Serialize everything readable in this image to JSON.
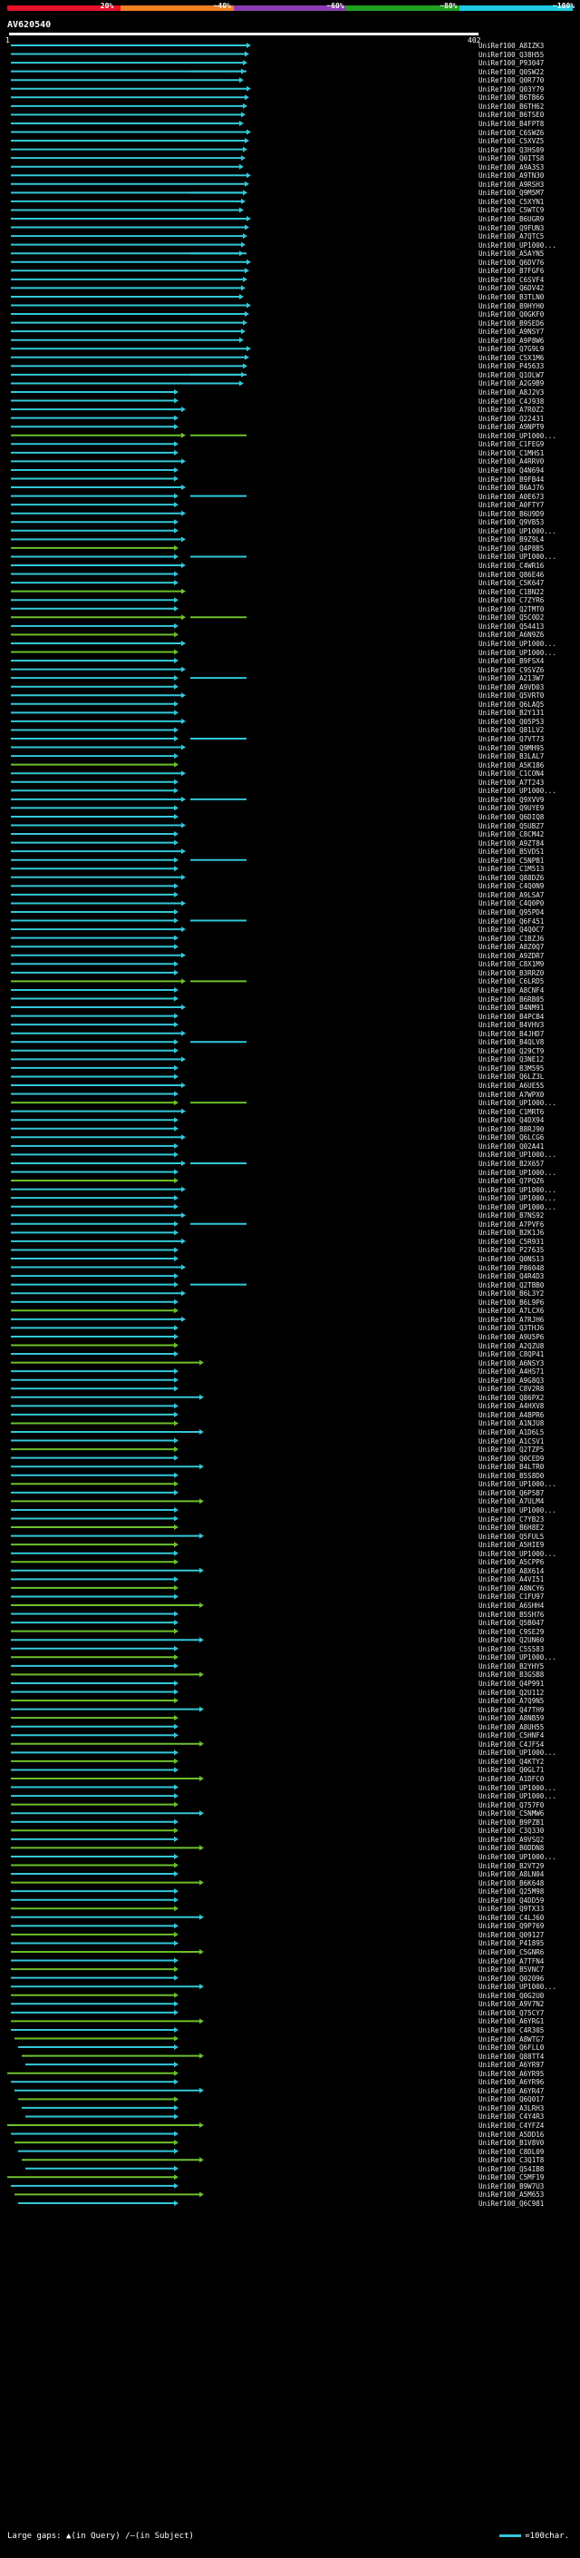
{
  "legend": {
    "labels": [
      "20%",
      "~40%",
      "~60%",
      "~80%",
      "~100%"
    ],
    "colors": [
      "#e8102a",
      "#f08020",
      "#8a3db0",
      "#20a020",
      "#20c8e0"
    ]
  },
  "query": {
    "name": "AV620540",
    "start": "1",
    "end": "402"
  },
  "hits": [
    "UniRef100_A8IZK3",
    "UniRef100_Q38H55",
    "UniRef100_P93047",
    "UniRef100_Q0SW22",
    "UniRef100_Q0R770",
    "UniRef100_Q03Y79",
    "UniRef100_B6TB66",
    "UniRef100_B6TH62",
    "UniRef100_B6TSE0",
    "UniRef100_B4FPT8",
    "UniRef100_C6SWZ6",
    "UniRef100_C5XVZ5",
    "UniRef100_Q3HS09",
    "UniRef100_Q0ITS8",
    "UniRef100_A9A3S3",
    "UniRef100_A9TN30",
    "UniRef100_A9RSH3",
    "UniRef100_Q9M5M7",
    "UniRef100_C5XYN1",
    "UniRef100_C5WTC9",
    "UniRef100_B6UGR9",
    "UniRef100_Q9FUN3",
    "UniRef100_A7QTC5",
    "UniRef100_UP1000...",
    "UniRef100_A5AYN5",
    "UniRef100_Q6DV76",
    "UniRef100_B7FGF6",
    "UniRef100_C6SVF4",
    "UniRef100_Q6DV42",
    "UniRef100_B3TLN0",
    "UniRef100_B9HYH0",
    "UniRef100_Q0GKF0",
    "UniRef100_B9SED6",
    "UniRef100_A9NSY7",
    "UniRef100_A9P8W6",
    "UniRef100_Q7G9L9",
    "UniRef100_C5X1M6",
    "UniRef100_P45633",
    "UniRef100_Q1OLW7",
    "UniRef100_A2G9B9",
    "UniRef100_A8J2V3",
    "UniRef100_C4J938",
    "UniRef100_A7R0Z2",
    "UniRef100_Q22431",
    "UniRef100_A9NPT9",
    "UniRef100_UP1000...",
    "UniRef100_C1FEG9",
    "UniRef100_C1MHS1",
    "UniRef100_A4RRV0",
    "UniRef100_Q4N694",
    "UniRef100_B9FB44",
    "UniRef100_B6AJ76",
    "UniRef100_A0E673",
    "UniRef100_A0FTY7",
    "UniRef100_B6U9D9",
    "UniRef100_Q9VB53",
    "UniRef100_UP1000...",
    "UniRef100_B9Z9L4",
    "UniRef100_Q4P8B5",
    "UniRef100_UP1000...",
    "UniRef100_C4WR16",
    "UniRef100_Q86E46",
    "UniRef100_C5K647",
    "UniRef100_C1BN22",
    "UniRef100_C7ZYR6",
    "UniRef100_Q2TMT0",
    "UniRef100_Q5C0D2",
    "UniRef100_Q54413",
    "UniRef100_A6N9Z6",
    "UniRef100_UP1000...",
    "UniRef100_UP1000...",
    "UniRef100_B9FSX4",
    "UniRef100_C9SVZ6",
    "UniRef100_A213W7",
    "UniRef100_A9VD03",
    "UniRef100_Q5VRT0",
    "UniRef100_Q6LAQ5",
    "UniRef100_B2Y131",
    "UniRef100_Q05P53",
    "UniRef100_Q81LV2",
    "UniRef100_Q7VT73",
    "UniRef100_Q9MH95",
    "UniRef100_B3LAL7",
    "UniRef100_A5K186",
    "UniRef100_C1CON4",
    "UniRef100_A7T243",
    "UniRef100_UP1000...",
    "UniRef100_Q9XVV9",
    "UniRef100_Q9UYE9",
    "UniRef100_Q6DIQ8",
    "UniRef100_Q5UBZ7",
    "UniRef100_C8CM42",
    "UniRef100_A9ZT84",
    "UniRef100_B5VDS1",
    "UniRef100_C5NPB1",
    "UniRef100_C1M513",
    "UniRef100_Q88DZ6",
    "UniRef100_C4Q0N9",
    "UniRef100_A9LSA7",
    "UniRef100_C4Q0P0",
    "UniRef100_Q95PD4",
    "UniRef100_Q6F451",
    "UniRef100_Q4Q0C7",
    "UniRef100_C1BZJ6",
    "UniRef100_A8Z0Q7",
    "UniRef100_A9ZDR7",
    "UniRef100_C8X1M9",
    "UniRef100_B3RRZ0",
    "UniRef100_C6LRD5",
    "UniRef100_A8CNF4",
    "UniRef100_B6RB05",
    "UniRef100_B4NM91",
    "UniRef100_B4PCB4",
    "UniRef100_B4VHV3",
    "UniRef100_B4JHD7",
    "UniRef100_B4QLV8",
    "UniRef100_Q29CT9",
    "UniRef100_Q3NE12",
    "UniRef100_B3M595",
    "UniRef100_Q6LZ3L",
    "UniRef100_A6UE55",
    "UniRef100_A7WPX0",
    "UniRef100_UP1000...",
    "UniRef100_C1MRT6",
    "UniRef100_Q4DX94",
    "UniRef100_B8RJ90",
    "UniRef100_Q6LCG6",
    "UniRef100_Q02A41",
    "UniRef100_UP1000...",
    "UniRef100_B2X657",
    "UniRef100_UP1000...",
    "UniRef100_Q7PQZ6",
    "UniRef100_UP1000...",
    "UniRef100_UP1000...",
    "UniRef100_UP1000...",
    "UniRef100_B7NS92",
    "UniRef100_A7PVF6",
    "UniRef100_B2K1J6",
    "UniRef100_C5R931",
    "UniRef100_P27635",
    "UniRef100_Q0NS13",
    "UniRef100_P86048",
    "UniRef100_Q4R4D3",
    "UniRef100_Q2TBB0",
    "UniRef100_B6L3Y2",
    "UniRef100_B6L9P6",
    "UniRef100_A7LCX6",
    "UniRef100_A7RJH6",
    "UniRef100_Q3THJ6",
    "UniRef100_A9U5P6",
    "UniRef100_A2QZU8",
    "UniRef100_C8QP41",
    "UniRef100_A6NSY3",
    "UniRef100_A4HS71",
    "UniRef100_A9G8Q3",
    "UniRef100_C8V2R8",
    "UniRef100_Q86PX2",
    "UniRef100_A4HXV8",
    "UniRef100_A4BPR6",
    "UniRef100_A1NJU8",
    "UniRef100_A1D6L5",
    "UniRef100_A1CSV1",
    "UniRef100_Q2TZP5",
    "UniRef100_Q0CED9",
    "UniRef100_B4LTR0",
    "UniRef100_B5S8D0",
    "UniRef100_UP1000...",
    "UniRef100_Q6P5B7",
    "UniRef100_A7ULM4",
    "UniRef100_UP1000...",
    "UniRef100_C7YB23",
    "UniRef100_B6H8E2",
    "UniRef100_Q5FUL5",
    "UniRef100_A5HIE9",
    "UniRef100_UP1000...",
    "UniRef100_A5CPP6",
    "UniRef100_A8X614",
    "UniRef100_A4VI51",
    "UniRef100_A8NCY6",
    "UniRef100_C1FU97",
    "UniRef100_A6SHH4",
    "UniRef100_B5SH76",
    "UniRef100_Q5B047",
    "UniRef100_C9SE29",
    "UniRef100_Q2UN60",
    "UniRef100_C5S583",
    "UniRef100_UP1000...",
    "UniRef100_B2YHY5",
    "UniRef100_B3GSB8",
    "UniRef100_Q4P991",
    "UniRef100_Q2U112",
    "UniRef100_A7Q9N5",
    "UniRef100_Q47TH9",
    "UniRef100_A8NB59",
    "UniRef100_A8UH55",
    "UniRef100_C5HNF4",
    "UniRef100_C4JFS4",
    "UniRef100_UP1000...",
    "UniRef100_Q4KTY2",
    "UniRef100_Q0GL71",
    "UniRef100_A1DFC0",
    "UniRef100_UP1000...",
    "UniRef100_UP1000...",
    "UniRef100_Q757F0",
    "UniRef100_C5NMW6",
    "UniRef100_B9PZB1",
    "UniRef100_C3Q330",
    "UniRef100_A9VSQ2",
    "UniRef100_B0DDN8",
    "UniRef100_UP1000...",
    "UniRef100_B2VT29",
    "UniRef100_A8LN04",
    "UniRef100_B6K648",
    "UniRef100_Q25M98",
    "UniRef100_Q4DD59",
    "UniRef100_Q9TX33",
    "UniRef100_C4LJ60",
    "UniRef100_Q9P769",
    "UniRef100_Q09127",
    "UniRef100_P41895",
    "UniRef100_C5GNR6",
    "UniRef100_A7TFN4",
    "UniRef100_B5VNC7",
    "UniRef100_Q02096",
    "UniRef100_UP1000...",
    "UniRef100_Q0G2U0",
    "UniRef100_A9V7N2",
    "UniRef100_Q75CY7",
    "UniRef100_A6YRG1",
    "UniRef100_C4R305",
    "UniRef100_A8WTG7",
    "UniRef100_Q6FLL0",
    "UniRef100_Q88TT4",
    "UniRef100_A6YR97",
    "UniRef100_A6YR95",
    "UniRef100_A6YR96",
    "UniRef100_A6YR47",
    "UniRef100_Q6Q017",
    "UniRef100_A3LRH3",
    "UniRef100_C4Y4R3",
    "UniRef100_C4YFZ4",
    "UniRef100_A5DD16",
    "UniRef100_B1V8V0",
    "UniRef100_C8DL09",
    "UniRef100_C3Q1T8",
    "UniRef100_Q54IB8",
    "UniRef100_C5MF19",
    "UniRef100_B9W7U3",
    "UniRef100_A5M653",
    "UniRef100_Q6C981"
  ],
  "footer": {
    "large_gaps_label": "Large gaps:",
    "query_gap": "(in Query)",
    "subject_gap": "(in Subject)",
    "scale_label": "=100char."
  }
}
